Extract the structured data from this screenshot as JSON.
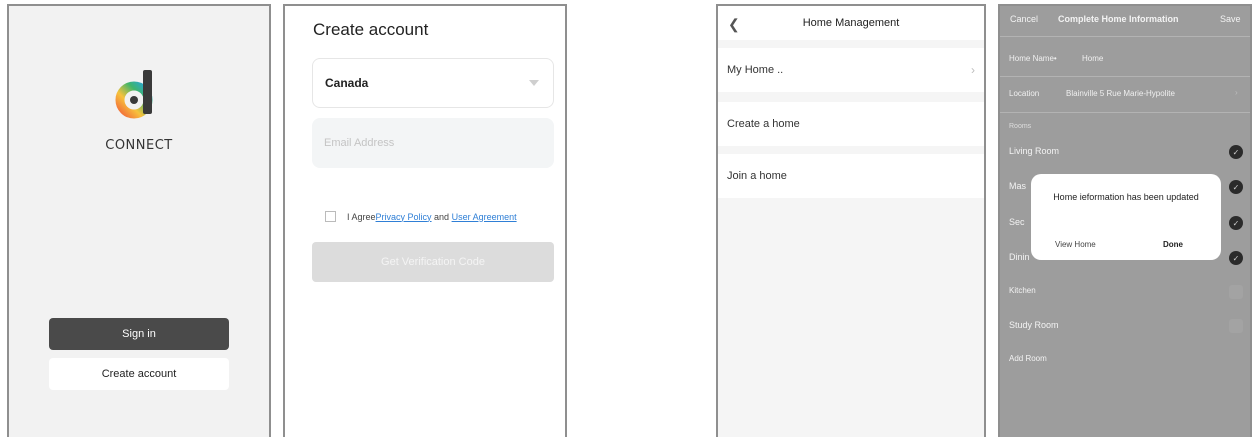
{
  "splash": {
    "brand": "CONNECT",
    "sign_in": "Sign in",
    "create_account": "Create account"
  },
  "create_account": {
    "title": "Create account",
    "country": "Canada",
    "email_placeholder": "Email Address",
    "agree_prefix": "I Agree",
    "privacy_policy": "Privacy Policy",
    "agree_and": " and ",
    "user_agreement": "User Agreement",
    "get_code": "Get Verification Code"
  },
  "home_management": {
    "title": "Home Management",
    "rows": [
      "My Home ..",
      "Create a home",
      "Join a home"
    ]
  },
  "home_info": {
    "cancel": "Cancel",
    "title": "Complete Home Information",
    "save": "Save",
    "home_name_label": "Home Name•",
    "home_name_value": "Home",
    "location_label": "Location",
    "location_value": "Blainville 5 Rue Marie-Hypolite",
    "rooms_label": "Rooms",
    "rooms": [
      "Living Room",
      "Mas",
      "Sec",
      "Dinin",
      "Kitchen",
      "Study Room"
    ],
    "add_room": "Add Room",
    "dialog": {
      "message": "Home ieformation has been updated",
      "view_home": "View Home",
      "done": "Done"
    }
  },
  "colors": {
    "dark_button": "#4a4a4a",
    "link": "#2f7fd6",
    "overlay": "#9d9d9d",
    "logo_gradient": [
      "#f26b3a",
      "#f7c23c",
      "#3fb56b",
      "#2aa6d9"
    ]
  }
}
